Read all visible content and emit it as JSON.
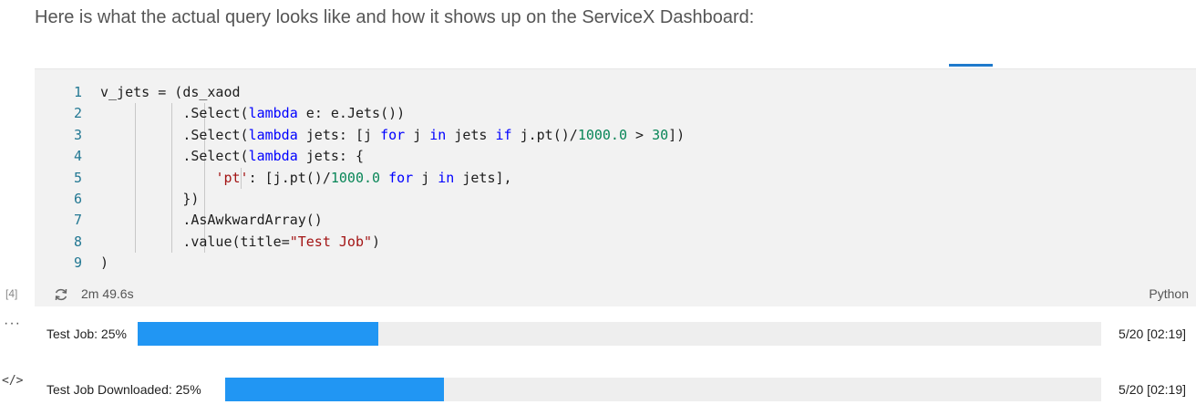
{
  "intro_text": "Here is what the actual query looks like and how it shows up on the ServiceX Dashboard:",
  "cell": {
    "execution_count": "[4]",
    "execution_time": "2m 49.6s",
    "language": "Python",
    "code_lines": [
      {
        "number": "1",
        "code": "v_jets = (ds_xaod"
      },
      {
        "number": "2",
        "code": "          .Select(lambda e: e.Jets())"
      },
      {
        "number": "3",
        "code": "          .Select(lambda jets: [j for j in jets if j.pt()/1000.0 > 30])"
      },
      {
        "number": "4",
        "code": "          .Select(lambda jets: {"
      },
      {
        "number": "5",
        "code": "              'pt': [j.pt()/1000.0 for j in jets],"
      },
      {
        "number": "6",
        "code": "          })"
      },
      {
        "number": "7",
        "code": "          .AsAwkwardArray()"
      },
      {
        "number": "8",
        "code": "          .value(title=\"Test Job\")"
      },
      {
        "number": "9",
        "code": ")"
      }
    ]
  },
  "output": {
    "more_icon": "ellipsis-icon",
    "code_icon": "code-icon",
    "progress_bars": [
      {
        "label": "Test Job: 25%",
        "fraction": 0.25,
        "status": "5/20 [02:19]"
      },
      {
        "label": "Test Job Downloaded: 25%",
        "fraction": 0.25,
        "status": "5/20 [02:19]"
      }
    ]
  },
  "colors": {
    "accent": "#1f7acc",
    "progress_fill": "#2196f3",
    "keyword": "#0000ff",
    "number": "#098658",
    "string": "#a31515",
    "line_number": "#237893"
  }
}
